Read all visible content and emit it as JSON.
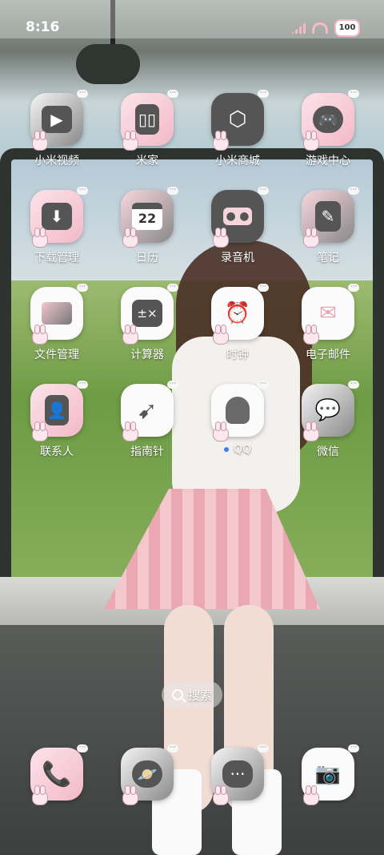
{
  "status_bar": {
    "time": "8:16",
    "battery": "100"
  },
  "apps": [
    {
      "label": "小米视频",
      "icon": "video-play-icon"
    },
    {
      "label": "米家",
      "icon": "fridge-icon"
    },
    {
      "label": "小米商城",
      "icon": "cube-icon"
    },
    {
      "label": "游戏中心",
      "icon": "gamepad-icon"
    },
    {
      "label": "下载管理",
      "icon": "download-folder-icon"
    },
    {
      "label": "日历",
      "icon": "calendar-icon",
      "day": "22"
    },
    {
      "label": "录音机",
      "icon": "recorder-icon"
    },
    {
      "label": "笔记",
      "icon": "notebook-icon"
    },
    {
      "label": "文件管理",
      "icon": "folder-icon"
    },
    {
      "label": "计算器",
      "icon": "calculator-icon"
    },
    {
      "label": "时钟",
      "icon": "alarm-clock-icon"
    },
    {
      "label": "电子邮件",
      "icon": "mail-icon"
    },
    {
      "label": "联系人",
      "icon": "contacts-icon"
    },
    {
      "label": "指南针",
      "icon": "compass-icon"
    },
    {
      "label": "QQ",
      "icon": "qq-penguin-icon"
    },
    {
      "label": "微信",
      "icon": "wechat-icon"
    }
  ],
  "search": {
    "label": "搜索"
  },
  "dock": [
    {
      "icon": "phone-icon"
    },
    {
      "icon": "browser-planet-icon"
    },
    {
      "icon": "messages-icon"
    },
    {
      "icon": "camera-icon"
    }
  ]
}
